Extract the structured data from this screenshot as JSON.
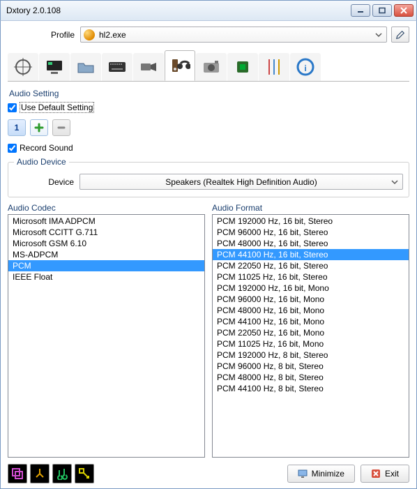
{
  "window": {
    "title": "Dxtory 2.0.108"
  },
  "profile": {
    "label": "Profile",
    "value": "hl2.exe"
  },
  "audio": {
    "section": "Audio Setting",
    "use_default": "Use Default Setting",
    "channel_num": "1",
    "record_sound": "Record Sound",
    "device_section": "Audio Device",
    "device_label": "Device",
    "device_value": "Speakers (Realtek High Definition Audio)",
    "codec_label": "Audio Codec",
    "format_label": "Audio Format",
    "codecs": [
      "Microsoft IMA ADPCM",
      "Microsoft CCITT G.711",
      "Microsoft GSM 6.10",
      "MS-ADPCM",
      "PCM",
      "IEEE Float"
    ],
    "codec_selected": 4,
    "formats": [
      "PCM 192000 Hz, 16 bit, Stereo",
      "PCM 96000 Hz, 16 bit, Stereo",
      "PCM 48000 Hz, 16 bit, Stereo",
      "PCM 44100 Hz, 16 bit, Stereo",
      "PCM 22050 Hz, 16 bit, Stereo",
      "PCM 11025 Hz, 16 bit, Stereo",
      "PCM 192000 Hz, 16 bit, Mono",
      "PCM 96000 Hz, 16 bit, Mono",
      "PCM 48000 Hz, 16 bit, Mono",
      "PCM 44100 Hz, 16 bit, Mono",
      "PCM 22050 Hz, 16 bit, Mono",
      "PCM 11025 Hz, 16 bit, Mono",
      "PCM 192000 Hz, 8 bit, Stereo",
      "PCM 96000 Hz, 8 bit, Stereo",
      "PCM 48000 Hz, 8 bit, Stereo",
      "PCM 44100 Hz, 8 bit, Stereo"
    ],
    "format_selected": 3
  },
  "buttons": {
    "minimize": "Minimize",
    "exit": "Exit"
  }
}
